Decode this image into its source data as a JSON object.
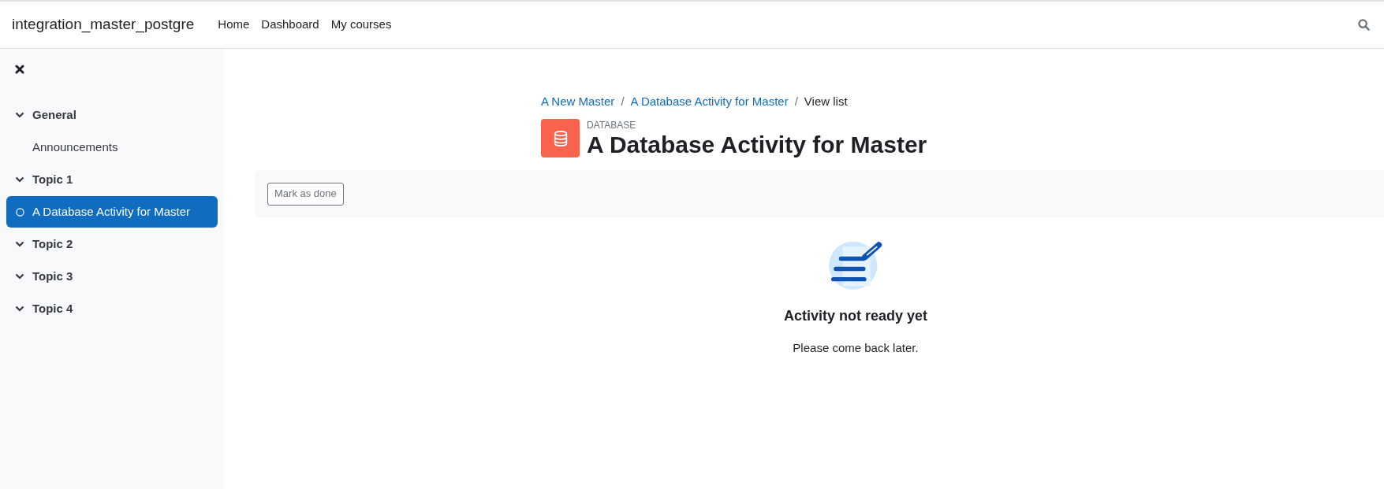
{
  "navbar": {
    "brand": "integration_master_postgre",
    "links": [
      "Home",
      "Dashboard",
      "My courses"
    ]
  },
  "sidebar": {
    "items": [
      {
        "kind": "section",
        "label": "General",
        "expanded": true,
        "selected": false
      },
      {
        "kind": "activity",
        "label": "Announcements",
        "selected": false,
        "completion": false
      },
      {
        "kind": "section",
        "label": "Topic 1",
        "expanded": true,
        "selected": false
      },
      {
        "kind": "activity",
        "label": "A Database Activity for Master",
        "selected": true,
        "completion": true
      },
      {
        "kind": "section",
        "label": "Topic 2",
        "expanded": true,
        "selected": false
      },
      {
        "kind": "section",
        "label": "Topic 3",
        "expanded": true,
        "selected": false
      },
      {
        "kind": "section",
        "label": "Topic 4",
        "expanded": true,
        "selected": false
      }
    ]
  },
  "breadcrumb": [
    "A New Master",
    "A Database Activity for Master",
    "View list"
  ],
  "breadcrumb_separator": "/",
  "header": {
    "type": "DATABASE",
    "title": "A Database Activity for Master"
  },
  "completion_bar": {
    "button": "Mark as done"
  },
  "notice": {
    "heading": "Activity not ready yet",
    "message": "Please come back later."
  }
}
